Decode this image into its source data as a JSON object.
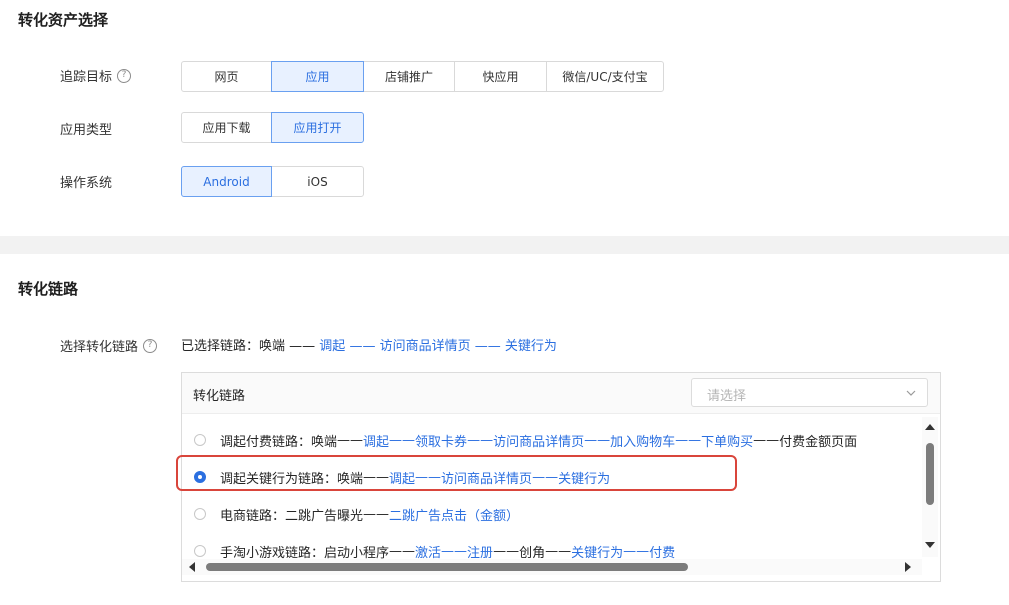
{
  "section1": {
    "title": "转化资产选择",
    "track_target": {
      "label": "追踪目标",
      "options": [
        "网页",
        "应用",
        "店铺推广",
        "快应用",
        "微信/UC/支付宝"
      ]
    },
    "app_type": {
      "label": "应用类型",
      "options": [
        "应用下载",
        "应用打开"
      ]
    },
    "os": {
      "label": "操作系统",
      "options": [
        "Android",
        "iOS"
      ]
    }
  },
  "section2": {
    "title": "转化链路",
    "select_label": "选择转化链路",
    "selected_prefix": "已选择链路：",
    "selected_path": [
      "唤端",
      "调起",
      "访问商品详情页",
      "关键行为"
    ],
    "panel": {
      "header": "转化链路",
      "select_placeholder": "请选择",
      "rows": [
        {
          "name": "调起付费链路：",
          "steps": [
            "唤端",
            "调起",
            "领取卡券",
            "访问商品详情页",
            "加入购物车",
            "下单购买",
            "付费金额页面"
          ],
          "selected": false
        },
        {
          "name": "调起关键行为链路：",
          "steps": [
            "唤端",
            "调起",
            "访问商品详情页",
            "关键行为"
          ],
          "selected": true
        },
        {
          "name": "电商链路：",
          "steps": [
            "二跳广告曝光",
            "二跳广告点击（金额）"
          ],
          "selected": false
        },
        {
          "name": "手淘小游戏链路：",
          "steps": [
            "启动小程序",
            "激活",
            "注册",
            "创角",
            "关键行为",
            "付费"
          ],
          "selected": false
        }
      ]
    }
  },
  "help_glyph": "?",
  "colors": {
    "accent": "#2b6fe0",
    "highlight": "#d9453b"
  }
}
